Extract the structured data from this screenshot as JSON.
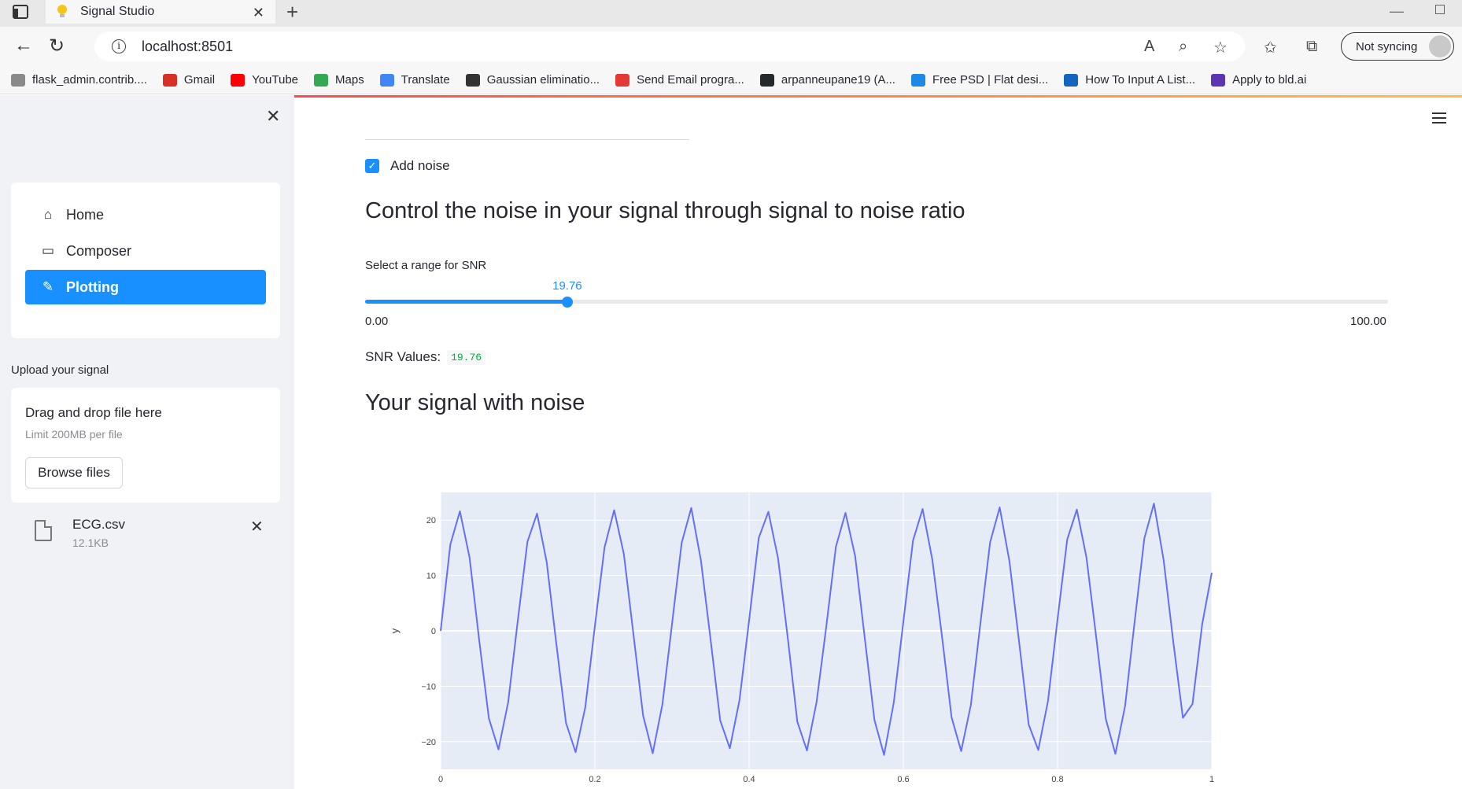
{
  "browser": {
    "tab_title": "Signal Studio",
    "tab_close": "✕",
    "new_tab": "+",
    "url": "localhost:8501",
    "sync_label": "Not syncing",
    "bookmarks": [
      {
        "label": "flask_admin.contrib....",
        "color": "#8a8a8a"
      },
      {
        "label": "Gmail",
        "color": "#d93025"
      },
      {
        "label": "YouTube",
        "color": "#ff0000"
      },
      {
        "label": "Maps",
        "color": "#34a853"
      },
      {
        "label": "Translate",
        "color": "#4285f4"
      },
      {
        "label": "Gaussian eliminatio...",
        "color": "#333333"
      },
      {
        "label": "Send Email progra...",
        "color": "#e53935"
      },
      {
        "label": "arpanneupane19 (A...",
        "color": "#24292e"
      },
      {
        "label": "Free PSD | Flat desi...",
        "color": "#1e88e5"
      },
      {
        "label": "How To Input A List...",
        "color": "#1565c0"
      },
      {
        "label": "Apply to bld.ai",
        "color": "#5e35b1"
      }
    ]
  },
  "sidebar": {
    "close": "✕",
    "menu": [
      {
        "label": "Home",
        "icon": "⌂",
        "active": false
      },
      {
        "label": "Composer",
        "icon": "▭",
        "active": false
      },
      {
        "label": "Plotting",
        "icon": "✎",
        "active": true
      }
    ],
    "upload_label": "Upload your signal",
    "drop_title": "Drag and drop file here",
    "drop_limit": "Limit 200MB per file",
    "browse_label": "Browse files",
    "file_name": "ECG.csv",
    "file_size": "12.1KB",
    "file_remove": "✕"
  },
  "main": {
    "add_noise_label": "Add noise",
    "add_noise_checked": true,
    "heading1": "Control the noise in your signal through signal to noise ratio",
    "slider_label": "Select a range for SNR",
    "slider_value_text": "19.76",
    "slider_min_text": "0.00",
    "slider_max_text": "100.00",
    "snr_label": "SNR Values:",
    "snr_value": "19.76",
    "heading2": "Your signal with noise"
  },
  "slider": {
    "min": 0,
    "max": 100,
    "value": 19.76
  },
  "colors": {
    "accent": "#1890ff",
    "trace": "#636efa",
    "plot_bg": "#e5ecf6"
  },
  "chart_data": {
    "type": "line",
    "title": "",
    "xlabel": "",
    "ylabel": "y",
    "xlim": [
      0,
      1
    ],
    "ylim": [
      -25,
      25
    ],
    "x_ticks": [
      0,
      0.2,
      0.4,
      0.6,
      0.8,
      1
    ],
    "x_tick_labels": [
      "0",
      "0.2",
      "0.4",
      "0.6",
      "0.8",
      "1"
    ],
    "y_ticks": [
      -20,
      -10,
      0,
      10,
      20
    ],
    "y_tick_labels": [
      "−20",
      "−10",
      "0",
      "10",
      "20"
    ],
    "grid": true,
    "series": [
      {
        "x": [
          0,
          0.0125,
          0.025,
          0.0375,
          0.05,
          0.0625,
          0.075,
          0.0875,
          0.1,
          0.1125,
          0.125,
          0.1375,
          0.15,
          0.1625,
          0.175,
          0.1875,
          0.2,
          0.2125,
          0.225,
          0.2375,
          0.25,
          0.2625,
          0.275,
          0.2875,
          0.3,
          0.3125,
          0.325,
          0.3375,
          0.35,
          0.3625,
          0.375,
          0.3875,
          0.4,
          0.4125,
          0.425,
          0.4375,
          0.45,
          0.4625,
          0.475,
          0.4875,
          0.5,
          0.5125,
          0.525,
          0.5375,
          0.55,
          0.5625,
          0.575,
          0.5875,
          0.6,
          0.6125,
          0.625,
          0.6375,
          0.65,
          0.6625,
          0.675,
          0.6875,
          0.7,
          0.7125,
          0.725,
          0.7375,
          0.75,
          0.7625,
          0.775,
          0.7875,
          0.8,
          0.8125,
          0.825,
          0.8375,
          0.85,
          0.8625,
          0.875,
          0.8875,
          0.9,
          0.9125,
          0.925,
          0.9375,
          0.95,
          0.9625,
          0.975,
          0.9875,
          1
        ],
        "y": [
          0,
          15.6,
          21.6,
          13.2,
          -1.7,
          -15.8,
          -21.4,
          -12.9,
          1.8,
          16.1,
          21.2,
          12.4,
          -2.3,
          -16.6,
          -21.9,
          -13.8,
          0.9,
          15.1,
          21.8,
          13.9,
          -0.6,
          -15.3,
          -22.1,
          -13.3,
          1.2,
          15.9,
          22.2,
          12.7,
          -1.5,
          -16.2,
          -21.2,
          -12.5,
          1.9,
          16.8,
          21.5,
          13.1,
          -1.1,
          -16.4,
          -21.6,
          -12.8,
          0.7,
          15.2,
          21.3,
          13.5,
          -1.3,
          -16.1,
          -22.4,
          -13.0,
          1.6,
          16.3,
          22.0,
          12.9,
          -0.8,
          -15.6,
          -21.7,
          -13.4,
          1.4,
          16.0,
          22.3,
          12.6,
          -1.8,
          -16.9,
          -21.5,
          -12.7,
          2.1,
          16.5,
          21.9,
          13.2,
          -1.0,
          -15.9,
          -22.2,
          -13.6,
          1.7,
          16.7,
          23.0,
          12.8,
          -1.9,
          -15.7,
          -13.2,
          1.2,
          10.5
        ]
      }
    ]
  }
}
